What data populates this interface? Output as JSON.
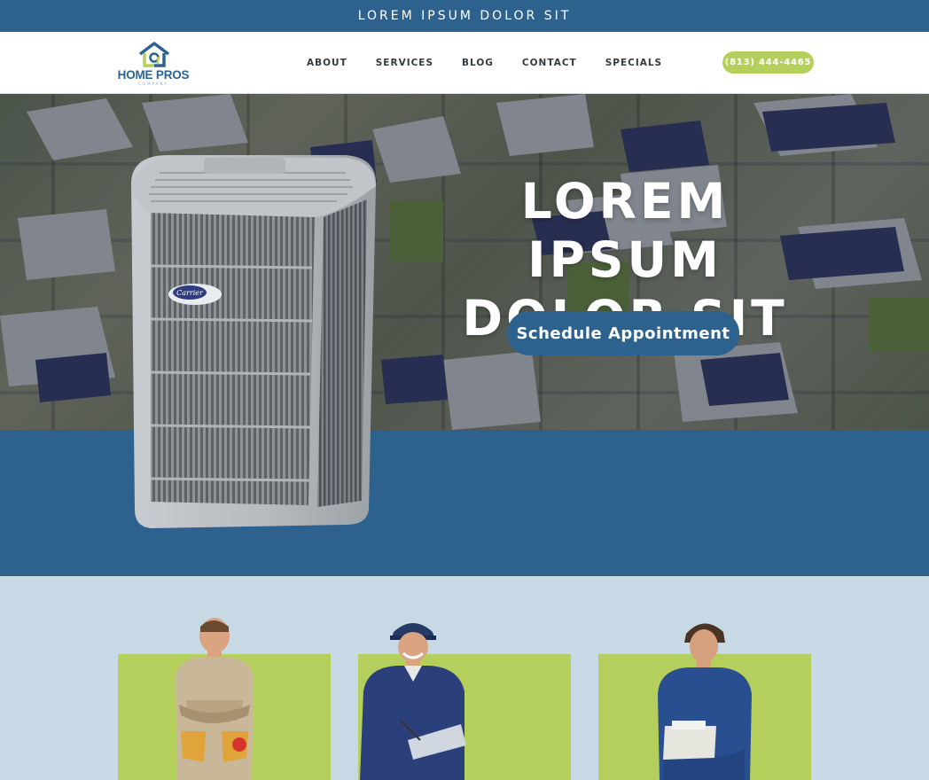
{
  "announcement": "LOREM IPSUM DOLOR SIT",
  "logo": {
    "name": "HOME PROS",
    "sub": "COMPANY"
  },
  "nav": {
    "items": [
      "ABOUT",
      "SERVICES",
      "BLOG",
      "CONTACT",
      "SPECIALS"
    ]
  },
  "phone": "(813) 444-4465",
  "hero": {
    "title_line1": "LOREM IPSUM",
    "title_line2": "DOLOR SIT",
    "cta": "Schedule Appointment",
    "unit_brand": "Carrier"
  },
  "colors": {
    "brand_blue": "#2c628d",
    "accent_green": "#b5cf5d",
    "pale_blue": "#c6d9e4"
  },
  "icons": [
    "house-logo-icon"
  ]
}
